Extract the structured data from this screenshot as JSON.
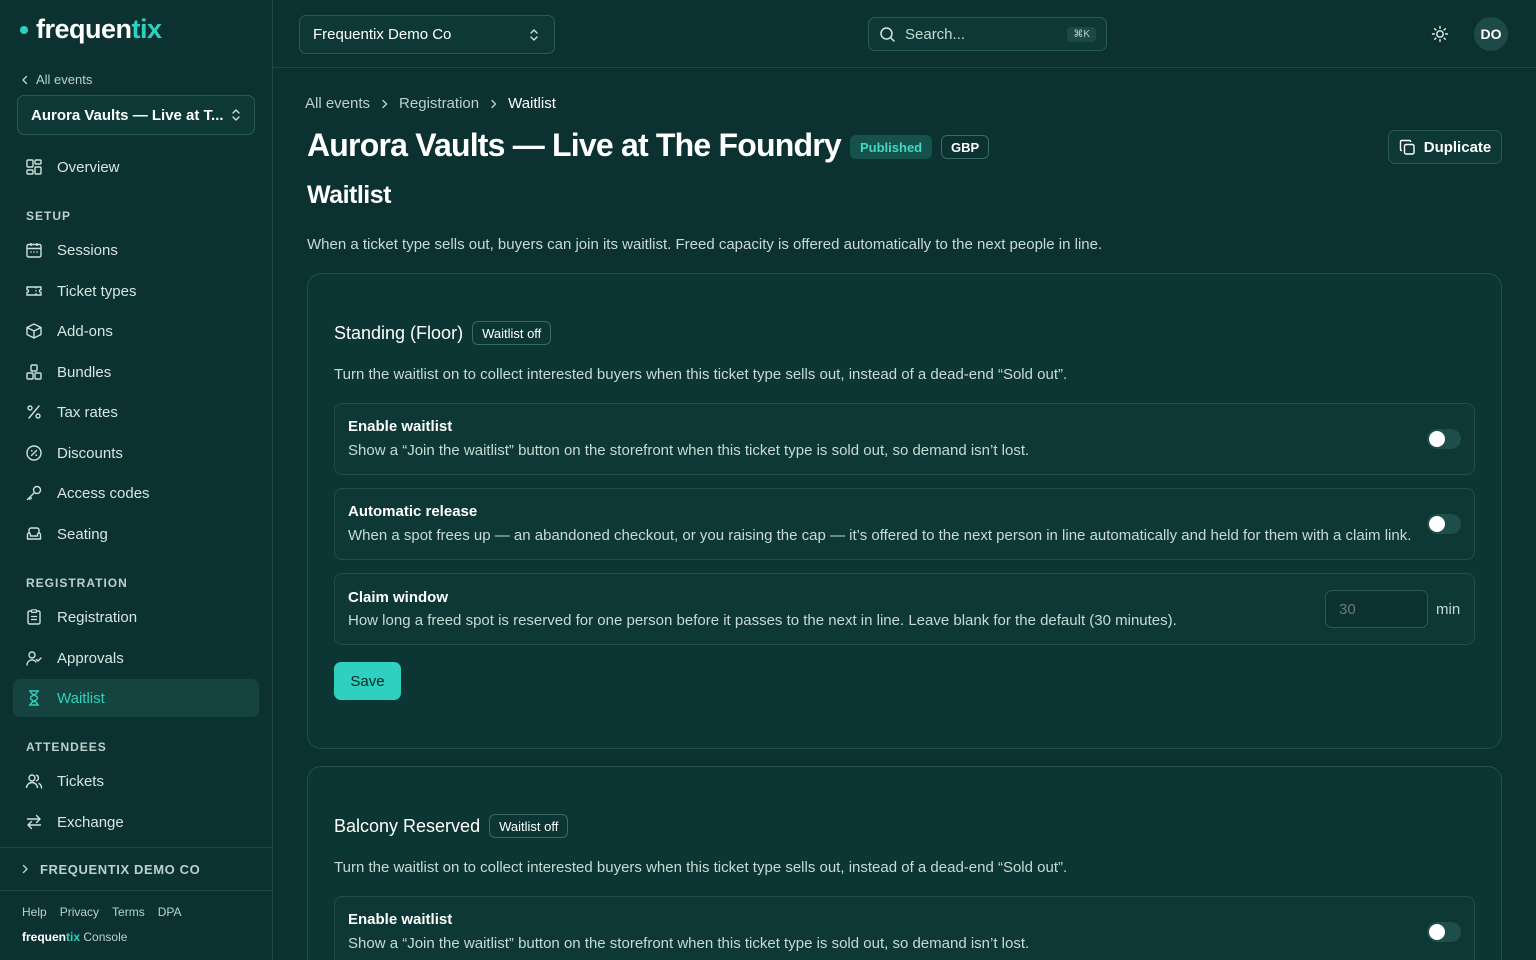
{
  "brand": {
    "name_main": "frequen",
    "name_accent": "tix",
    "console_label": "Console"
  },
  "sidebar": {
    "back_label": "All events",
    "event_selector": "Aurora Vaults — Live at T...",
    "overview_label": "Overview",
    "sections": {
      "setup": "SETUP",
      "registration": "REGISTRATION",
      "attendees": "ATTENDEES"
    },
    "setup_items": [
      "Sessions",
      "Ticket types",
      "Add-ons",
      "Bundles",
      "Tax rates",
      "Discounts",
      "Access codes",
      "Seating"
    ],
    "registration_items": [
      "Registration",
      "Approvals",
      "Waitlist"
    ],
    "attendee_items": [
      "Tickets",
      "Exchange"
    ],
    "active_item": "Waitlist",
    "org_label": "FREQUENTIX DEMO CO",
    "footer_links": [
      "Help",
      "Privacy",
      "Terms",
      "DPA"
    ]
  },
  "topbar": {
    "org_selector": "Frequentix Demo Co",
    "search_placeholder": "Search...",
    "search_shortcut": "⌘K",
    "avatar_initials": "DO"
  },
  "breadcrumb": [
    "All events",
    "Registration",
    "Waitlist"
  ],
  "page": {
    "title": "Aurora Vaults — Live at The Foundry",
    "status_badge": "Published",
    "currency_badge": "GBP",
    "duplicate_label": "Duplicate",
    "section_title": "Waitlist",
    "description": "When a ticket type sells out, buyers can join its waitlist. Freed capacity is offered automatically to the next people in line."
  },
  "cards": [
    {
      "title": "Standing (Floor)",
      "badge": "Waitlist off",
      "description": "Turn the waitlist on to collect interested buyers when this ticket type sells out, instead of a dead-end “Sold out”.",
      "enable": {
        "label": "Enable waitlist",
        "help": "Show a “Join the waitlist” button on the storefront when this ticket type is sold out, so demand isn’t lost.",
        "on": false
      },
      "auto_release": {
        "label": "Automatic release",
        "help": "When a spot frees up — an abandoned checkout, or you raising the cap — it’s offered to the next person in line automatically and held for them with a claim link.",
        "on": false
      },
      "claim_window": {
        "label": "Claim window",
        "help": "How long a freed spot is reserved for one person before it passes to the next in line. Leave blank for the default (30 minutes).",
        "placeholder": "30",
        "unit": "min"
      },
      "save_label": "Save"
    },
    {
      "title": "Balcony Reserved",
      "badge": "Waitlist off",
      "description": "Turn the waitlist on to collect interested buyers when this ticket type sells out, instead of a dead-end “Sold out”.",
      "enable": {
        "label": "Enable waitlist",
        "help": "Show a “Join the waitlist” button on the storefront when this ticket type is sold out, so demand isn’t lost.",
        "on": false
      }
    }
  ],
  "colors": {
    "background": "#0b3230",
    "accent": "#2fd0bf",
    "border": "#1d4a46"
  }
}
